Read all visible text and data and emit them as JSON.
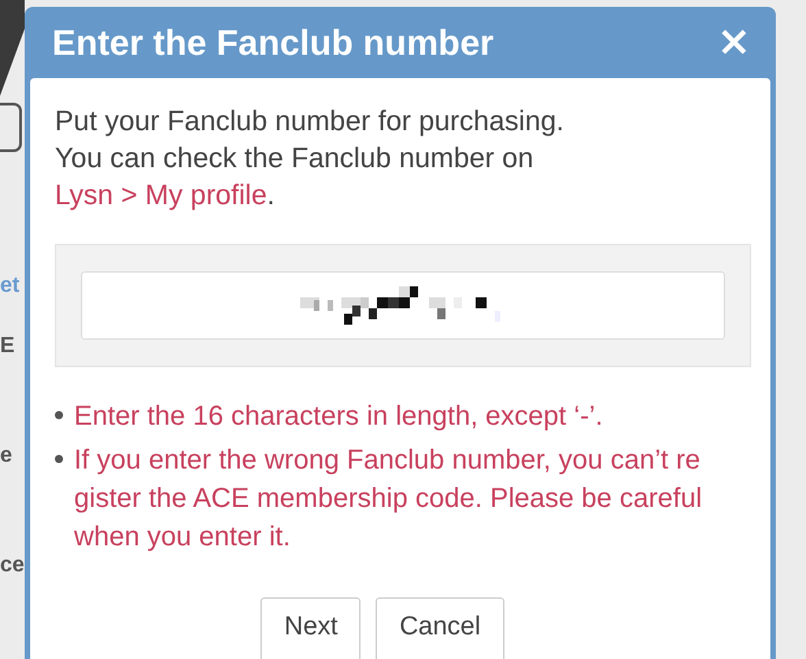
{
  "background": {
    "fragments": [
      {
        "text": "et",
        "kind": "link"
      },
      {
        "text": "E",
        "kind": "label"
      },
      {
        "text": "e",
        "kind": "label"
      },
      {
        "text": "ce",
        "kind": "label"
      }
    ]
  },
  "dialog": {
    "title": "Enter the Fanclub number",
    "close": "×",
    "intro": [
      "Put your Fanclub number for purchasing.",
      "You can check the Fanclub number on"
    ],
    "link": "Lysn > My profile",
    "link_after": ".",
    "field": {
      "masked": true
    },
    "notes": [
      "Enter the 16 characters in length, except ‘-’.",
      "If you enter the wrong Fanclub number, you can’t re gister the ACE membership code. Please be careful when you enter it."
    ],
    "buttons": [
      "Next",
      "Cancel"
    ]
  }
}
